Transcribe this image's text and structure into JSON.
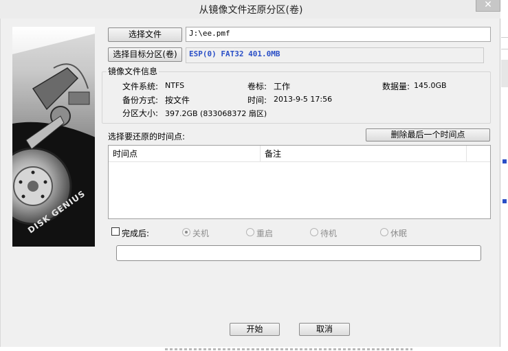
{
  "window": {
    "title": "从镜像文件还原分区(卷)",
    "close_icon": "close-icon"
  },
  "logo": {
    "brand_text": "DISK GENIUS",
    "icon": "hard-disk-icon"
  },
  "source": {
    "button_label": "选择文件",
    "file_path": "J:\\ee.pmf"
  },
  "target": {
    "button_label": "选择目标分区(卷)",
    "partition": "ESP(0) FAT32 401.0MB",
    "accent_color": "#2a4fc7"
  },
  "image_info": {
    "group_title": "镜像文件信息",
    "filesystem_label": "文件系统:",
    "filesystem_value": "NTFS",
    "volume_label_label": "卷标:",
    "volume_label_value": "工作",
    "data_size_label": "数据量:",
    "data_size_value": "145.0GB",
    "backup_mode_label": "备份方式:",
    "backup_mode_value": "按文件",
    "time_label": "时间:",
    "time_value": "2013-9-5 17:56",
    "partition_size_label": "分区大小:",
    "partition_size_value": "397.2GB  (833068372 扇区)"
  },
  "timepoints": {
    "label": "选择要还原的时间点:",
    "delete_button": "删除最后一个时间点",
    "columns": [
      "时间点",
      "备注"
    ],
    "rows": []
  },
  "completion": {
    "checkbox_label": "完成后:",
    "checked": false,
    "options": [
      "关机",
      "重启",
      "待机",
      "休眠"
    ],
    "selected": "关机"
  },
  "progress": {
    "value": 0
  },
  "actions": {
    "start_label": "开始",
    "cancel_label": "取消"
  }
}
